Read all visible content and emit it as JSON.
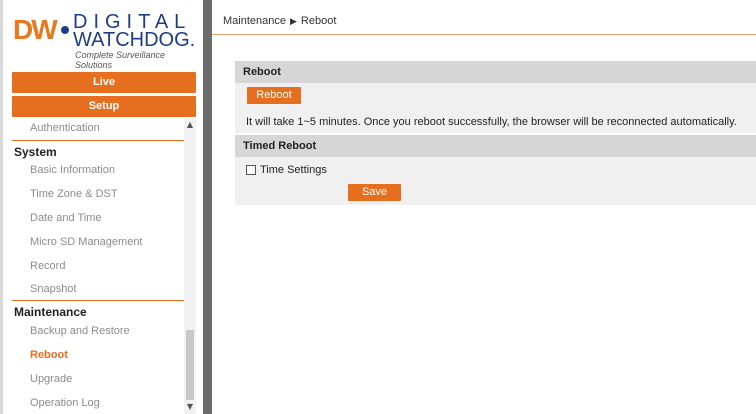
{
  "logo": {
    "mark": "DW",
    "brand_line1": "DIGITAL",
    "brand_line2": "WATCHDOG.",
    "tagline": "Complete Surveillance Solutions"
  },
  "nav": {
    "live_label": "Live",
    "setup_label": "Setup"
  },
  "sidebar": {
    "items": [
      {
        "label": "Authentication"
      },
      {
        "label": "System"
      },
      {
        "label": "Basic Information"
      },
      {
        "label": "Time Zone & DST"
      },
      {
        "label": "Date and Time"
      },
      {
        "label": "Micro SD Management"
      },
      {
        "label": "Record"
      },
      {
        "label": "Snapshot"
      },
      {
        "label": "Maintenance"
      },
      {
        "label": "Backup and Restore"
      },
      {
        "label": "Reboot"
      },
      {
        "label": "Upgrade"
      },
      {
        "label": "Operation Log"
      }
    ]
  },
  "breadcrumb": {
    "parent": "Maintenance",
    "separator": "▶",
    "current": "Reboot"
  },
  "reboot_section": {
    "title": "Reboot",
    "button_label": "Reboot",
    "message": "It will take 1~5 minutes. Once you reboot successfully, the browser will be reconnected automatically."
  },
  "timed_reboot_section": {
    "title": "Timed Reboot",
    "checkbox_label": "Time Settings",
    "checkbox_checked": false,
    "save_label": "Save"
  },
  "colors": {
    "accent": "#e56f1f",
    "divider": "#6c6c6c",
    "panel_header": "#d6d6d6",
    "panel_body": "#f0f0f0"
  }
}
